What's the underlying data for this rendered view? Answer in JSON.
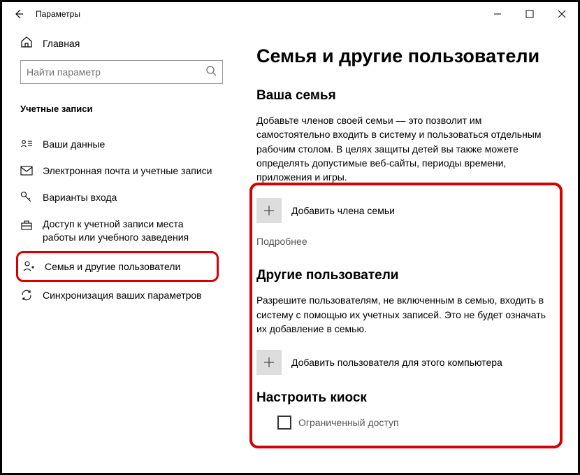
{
  "titlebar": {
    "title": "Параметры"
  },
  "sidebar": {
    "home": "Главная",
    "search_placeholder": "Найти параметр",
    "section": "Учетные записи",
    "items": [
      {
        "label": "Ваши данные"
      },
      {
        "label": "Электронная почта и учетные записи"
      },
      {
        "label": "Варианты входа"
      },
      {
        "label": "Доступ к учетной записи места работы или учебного заведения"
      },
      {
        "label": "Семья и другие пользователи"
      },
      {
        "label": "Синхронизация ваших параметров"
      }
    ]
  },
  "main": {
    "heading": "Семья и другие пользователи",
    "family": {
      "title": "Ваша семья",
      "desc": "Добавьте членов своей семьи — это позволит им самостоятельно входить в систему и пользоваться отдельным рабочим столом. В целях защиты детей вы также можете определять допустимые веб-сайты, периоды времени, приложения и игры.",
      "add": "Добавить члена семьи",
      "more": "Подробнее"
    },
    "others": {
      "title": "Другие пользователи",
      "desc": "Разрешите пользователям, не включенным в семью, входить в систему с помощью их учетных записей. Это не будет означать их добавление в семью.",
      "add": "Добавить пользователя для этого компьютера"
    },
    "kiosk": {
      "title": "Настроить киоск",
      "restricted": "Ограниченный доступ"
    }
  }
}
